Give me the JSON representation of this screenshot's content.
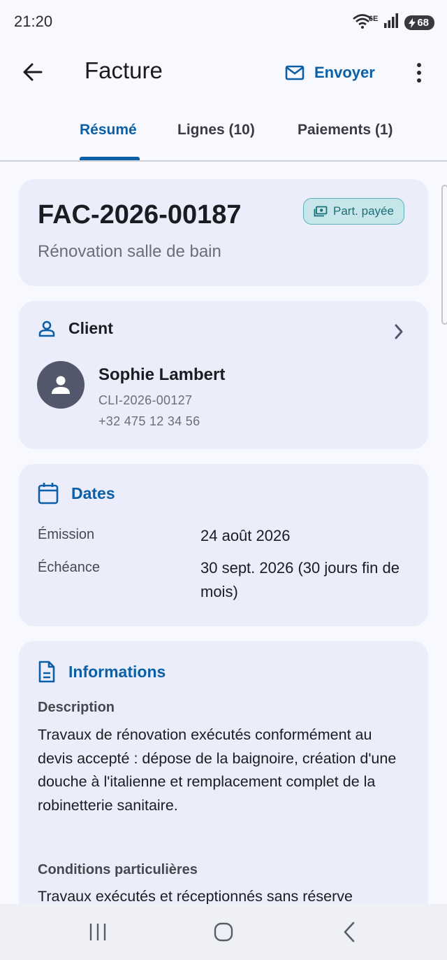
{
  "status": {
    "time": "21:20",
    "network": "6E",
    "battery": "68"
  },
  "app_bar": {
    "title": "Facture",
    "send_label": "Envoyer"
  },
  "tabs": [
    {
      "label": "Résumé",
      "active": true
    },
    {
      "label": "Lignes (10)",
      "active": false
    },
    {
      "label": "Paiements (1)",
      "active": false
    }
  ],
  "invoice": {
    "number": "FAC-2026-00187",
    "subtitle": "Rénovation salle de bain",
    "status_badge": "Part. payée"
  },
  "client": {
    "heading": "Client",
    "name": "Sophie Lambert",
    "code": "CLI-2026-00127",
    "phone": "+32 475 12 34 56"
  },
  "dates": {
    "heading": "Dates",
    "rows": [
      {
        "label": "Émission",
        "value": "24 août 2026"
      },
      {
        "label": "Échéance",
        "value": "30 sept. 2026 (30 jours fin de mois)"
      }
    ]
  },
  "informations": {
    "heading": "Informations",
    "description_label": "Description",
    "description": "Travaux de rénovation exécutés conformément au devis accepté : dépose de la baignoire, création d'une douche à l'italienne et remplacement complet de la robinetterie sanitaire.",
    "conditions_label": "Conditions particulières",
    "conditions": "Travaux exécutés et réceptionnés sans réserve"
  },
  "colors": {
    "accent": "#0b5fa6",
    "card": "#ebeefa",
    "badge_bg": "#c6e6ea",
    "badge_text": "#1b6f78"
  },
  "icons": [
    "arrow-back-icon",
    "mail-icon",
    "more-vert-icon",
    "payments-icon",
    "person-icon",
    "chevron-right-icon",
    "calendar-icon",
    "document-icon"
  ]
}
